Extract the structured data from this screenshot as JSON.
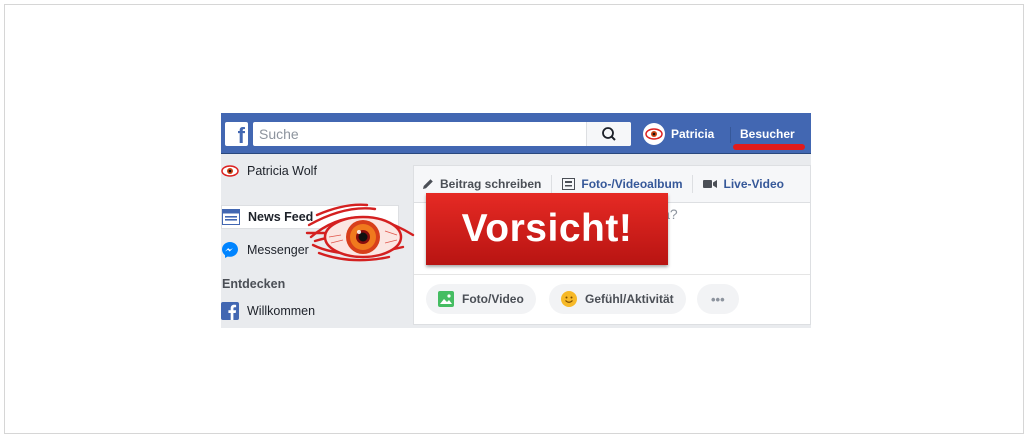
{
  "colors": {
    "facebook_blue": "#4267b2",
    "warning_red": "#e21b1b",
    "link_blue": "#365899"
  },
  "topbar": {
    "logo_letter": "f",
    "search_placeholder": "Suche",
    "user_name": "Patricia",
    "visitors_label": "Besucher"
  },
  "leftnav": {
    "profile_name": "Patricia Wolf",
    "items": [
      {
        "label": "News Feed",
        "icon": "news-feed-icon"
      },
      {
        "label": "Messenger",
        "icon": "messenger-icon"
      }
    ],
    "section_title": "Entdecken",
    "explore_items": [
      {
        "label": "Willkommen",
        "icon": "facebook-icon"
      }
    ]
  },
  "composer": {
    "tabs": [
      {
        "label": "Beitrag schreiben",
        "icon": "pencil-icon"
      },
      {
        "label": "Foto-/Videoalbum",
        "icon": "album-icon"
      },
      {
        "label": "Live-Video",
        "icon": "video-camera-icon"
      }
    ],
    "prompt_tail": "cia?",
    "actions": [
      {
        "label": "Foto/Video",
        "icon": "photo-icon"
      },
      {
        "label": "Gefühl/Aktivität",
        "icon": "smiley-icon"
      },
      {
        "label": "•••",
        "icon": "more-icon"
      }
    ]
  },
  "overlay": {
    "warning_text": "Vorsicht!",
    "icon": "red-eye-icon"
  }
}
